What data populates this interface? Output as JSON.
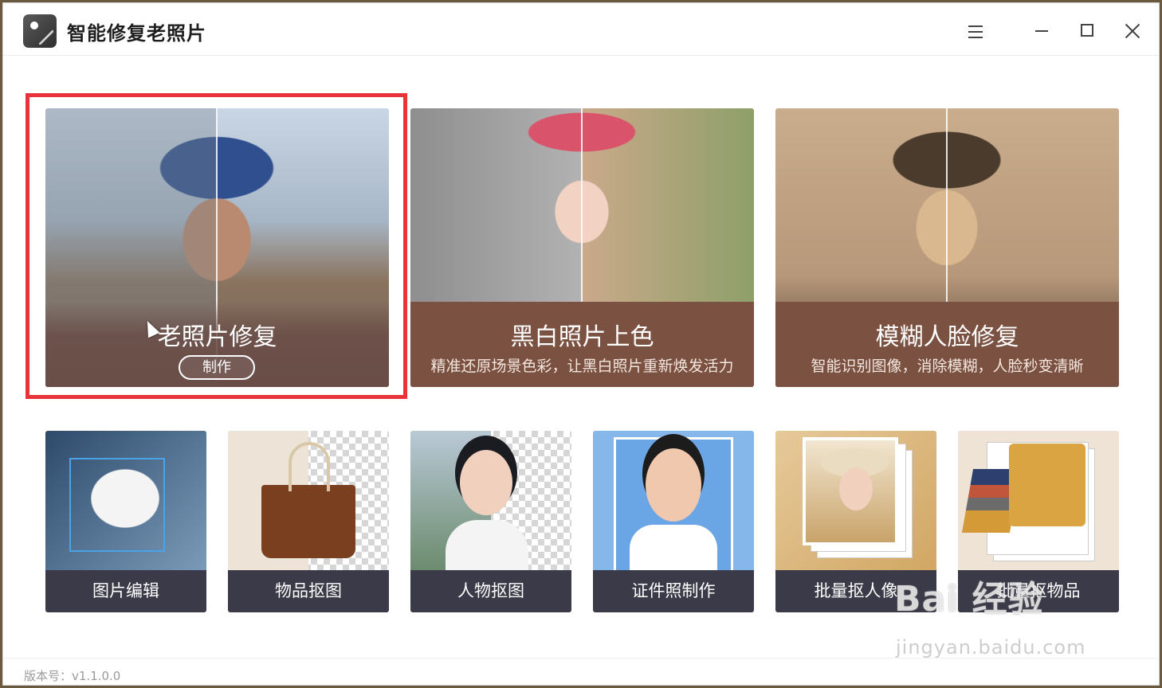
{
  "app": {
    "title": "智能修复老照片",
    "version": "版本号：v1.1.0.0"
  },
  "window_controls": {
    "menu": "menu-icon",
    "minimize": "minimize-icon",
    "maximize": "maximize-icon",
    "close": "close-icon"
  },
  "feature_cards": [
    {
      "title": "老照片修复",
      "button": "制作",
      "band_color": "#6a4d47"
    },
    {
      "title": "黑白照片上色",
      "desc": "精准还原场景色彩，让黑白照片重新焕发活力",
      "band_color": "#7b5141"
    },
    {
      "title": "模糊人脸修复",
      "desc": "智能识别图像，消除模糊，人脸秒变清晰",
      "band_color": "#7b5141"
    }
  ],
  "tools": [
    {
      "label": "图片编辑"
    },
    {
      "label": "物品抠图"
    },
    {
      "label": "人物抠图"
    },
    {
      "label": "证件照制作"
    },
    {
      "label": "批量抠人像"
    },
    {
      "label": "批量抠物品"
    }
  ],
  "watermark": {
    "main": "Bai 经验",
    "sub": "jingyan.baidu.com"
  },
  "colors": {
    "highlight": "#e8333b",
    "label_bar": "#3b3a48"
  }
}
